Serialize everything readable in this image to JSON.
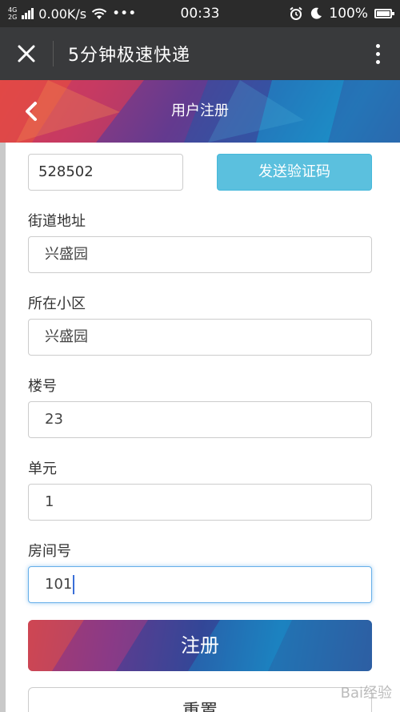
{
  "status_bar": {
    "net_top": "4G",
    "net_bottom": "2G",
    "speed": "0.00K/s",
    "dots": "•••",
    "time": "00:33",
    "battery": "100%"
  },
  "app_bar": {
    "title": "5分钟极速快递",
    "close_icon": "close-icon",
    "more_icon": "more-vertical-icon"
  },
  "header": {
    "title": "用户注册",
    "back_icon": "chevron-left-icon"
  },
  "form": {
    "code_value": "528502",
    "send_code_label": "发送验证码",
    "fields": [
      {
        "label": "街道地址",
        "value": "兴盛园"
      },
      {
        "label": "所在小区",
        "value": "兴盛园"
      },
      {
        "label": "楼号",
        "value": "23"
      },
      {
        "label": "单元",
        "value": "1"
      },
      {
        "label": "房间号",
        "value": "101"
      }
    ],
    "submit_label": "注册",
    "reset_label": "重置"
  },
  "colors": {
    "status_bar_bg": "#2b2b2b",
    "app_bar_bg": "#393a3c",
    "send_code_bg": "#5bc0de",
    "focus_border": "#66afe9"
  },
  "watermark": "Bai经验"
}
